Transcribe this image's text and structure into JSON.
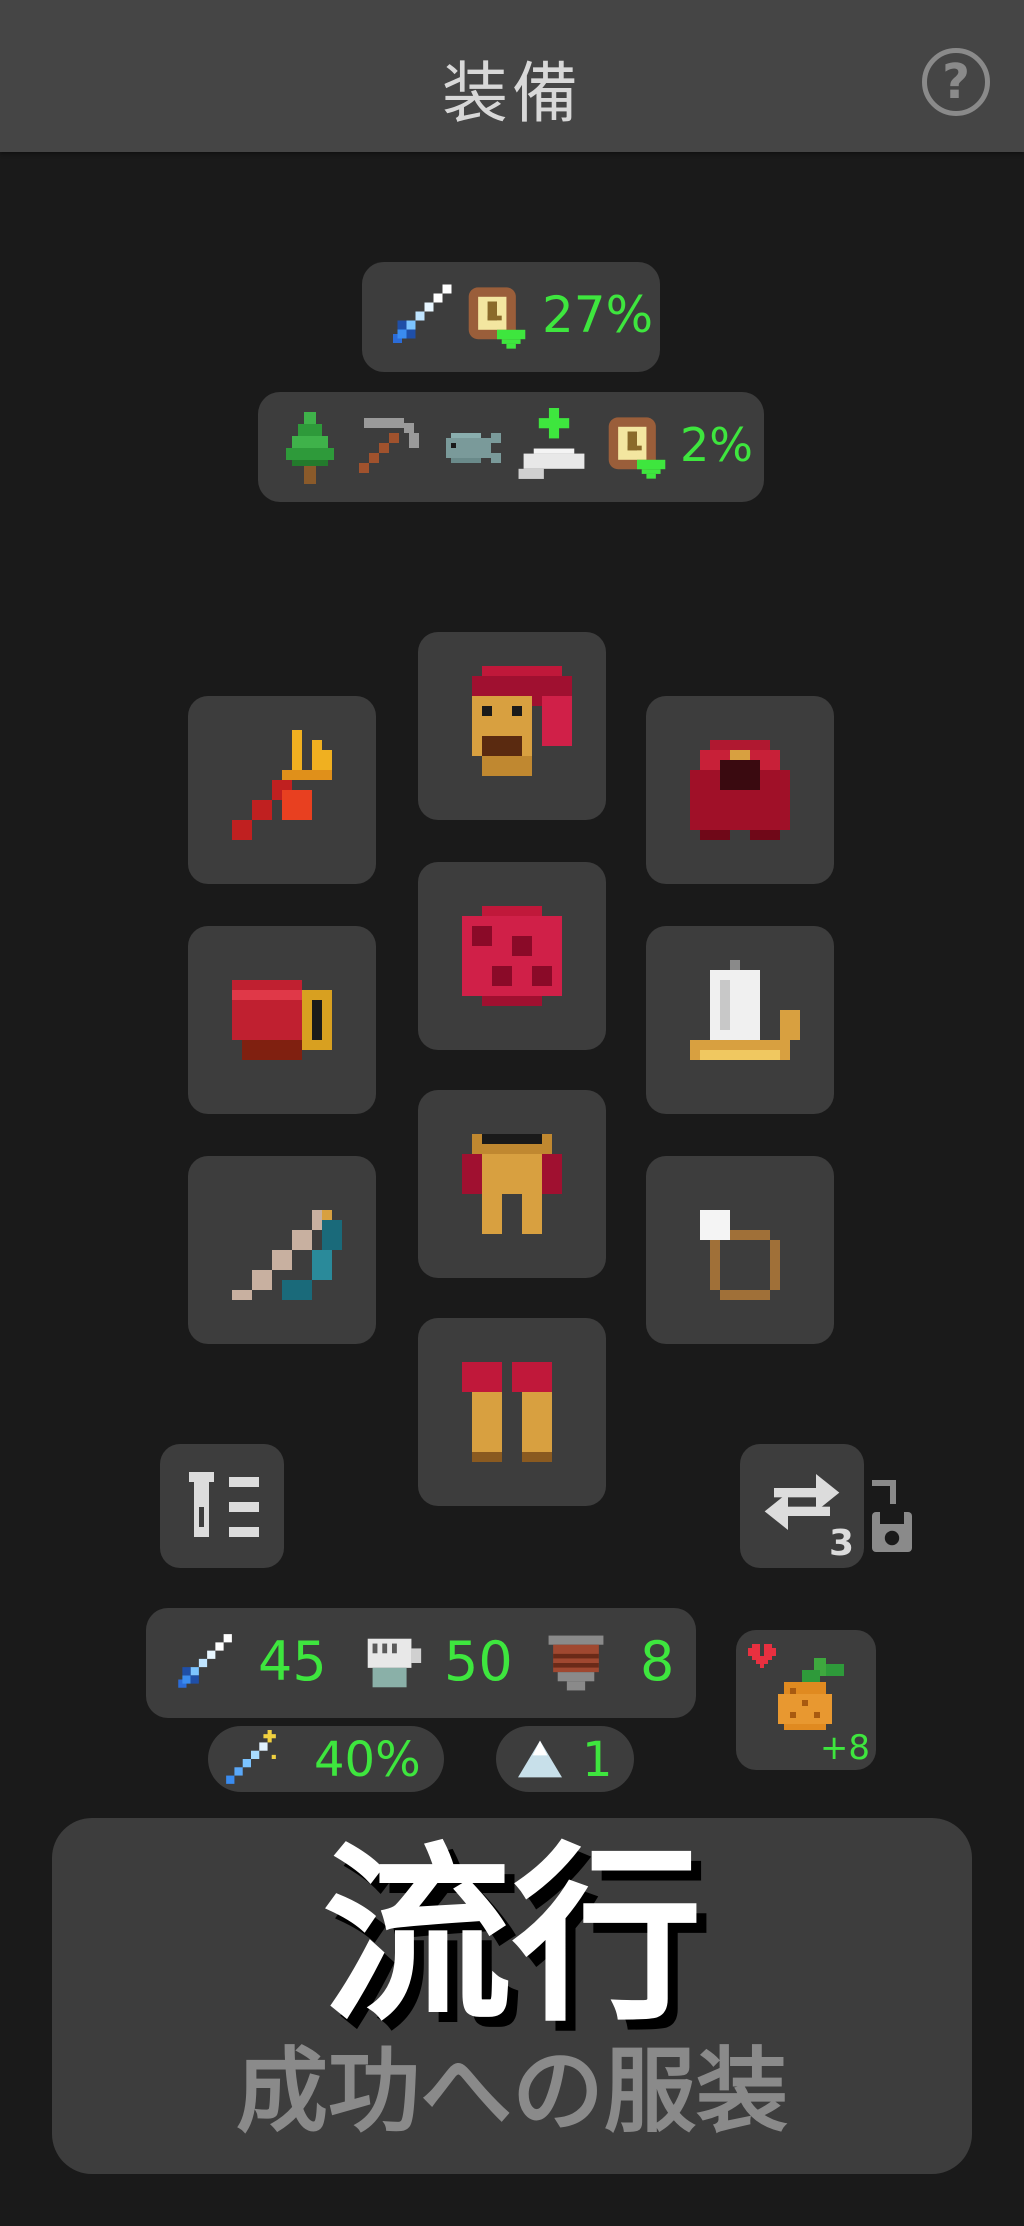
{
  "header": {
    "title": "装備",
    "help_icon": "question-circle-icon",
    "help_label": "?"
  },
  "bonus_main": {
    "icons": [
      "sword-icon",
      "exp-scroll-icon"
    ],
    "value": "27%"
  },
  "bonus_gathering": {
    "icons": [
      "tree-icon",
      "pickaxe-icon",
      "fish-icon",
      "hand-plus-icon",
      "exp-scroll-icon"
    ],
    "value": "2%"
  },
  "equipment": {
    "head": "lion-headdress-icon",
    "weapon": "trident-icon",
    "cape": "red-hood-cape-icon",
    "body": "feather-armor-icon",
    "bracers": "red-bracers-icon",
    "offhand": "candle-icon",
    "legs": "feather-skirt-icon",
    "ranged": "bow-icon",
    "ring": "pearl-ring-icon",
    "boots": "feather-boots-icon"
  },
  "potion_button": {
    "icon": "potion-list-icon"
  },
  "swap_button": {
    "icon": "swap-arrows-icon",
    "count": "3",
    "lock_icon": "unlocked-save-icon"
  },
  "stats": {
    "attack": {
      "icon": "sword-icon",
      "value": "45"
    },
    "strength": {
      "icon": "fist-icon",
      "value": "50"
    },
    "defense": {
      "icon": "shield-icon",
      "value": "8"
    },
    "crit": {
      "icon": "crit-wand-icon",
      "value": "40%"
    },
    "tier": {
      "icon": "mountain-icon",
      "value": "1"
    }
  },
  "food": {
    "icon": "pineapple-icon",
    "heart_icon": "heart-icon",
    "value": "+8"
  },
  "outfit": {
    "title": "流行",
    "subtitle": "成功への服装"
  },
  "colors": {
    "background": "#1a1a1a",
    "panel": "#3d3d3d",
    "header": "#454545",
    "accent_green": "#3ee63e"
  }
}
